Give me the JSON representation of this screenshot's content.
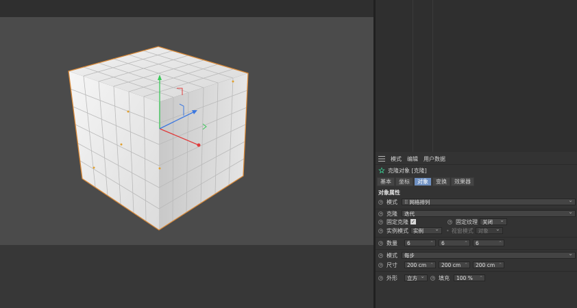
{
  "attributes": {
    "menu": [
      "模式",
      "编辑",
      "用户数据"
    ],
    "object_title": "克隆对象 [克隆]",
    "tabs": [
      {
        "label": "基本",
        "active": false
      },
      {
        "label": "坐标",
        "active": false
      },
      {
        "label": "对象",
        "active": true
      },
      {
        "label": "变换",
        "active": false
      },
      {
        "label": "效果器",
        "active": false
      }
    ],
    "section_title": "对象属性",
    "mode": {
      "label": "模式",
      "value": "网格排列"
    },
    "clone": {
      "label": "克隆",
      "value": "迭代"
    },
    "fix_clone": {
      "label": "固定克隆",
      "checked": true
    },
    "fix_texture": {
      "label": "固定纹理",
      "value": "关闭"
    },
    "instance_mode": {
      "label": "实例模式",
      "value": "实例"
    },
    "viewport_mode": {
      "label": "视窗模式",
      "value": "对象"
    },
    "count": {
      "label": "数量",
      "x": "6",
      "y": "6",
      "z": "6"
    },
    "mode2": {
      "label": "模式",
      "value": "每步"
    },
    "size": {
      "label": "尺寸",
      "x": "200 cm",
      "y": "200 cm",
      "z": "200 cm"
    },
    "shape": {
      "label": "外形",
      "value": "立方"
    },
    "fill": {
      "label": "填充",
      "value": "100 %"
    }
  },
  "colors": {
    "selection_outline": "#d98a3a",
    "active_tab": "#6e90c2",
    "axis_x": "#e03c3c",
    "axis_y": "#3cc85a",
    "axis_z": "#3c78e0"
  }
}
